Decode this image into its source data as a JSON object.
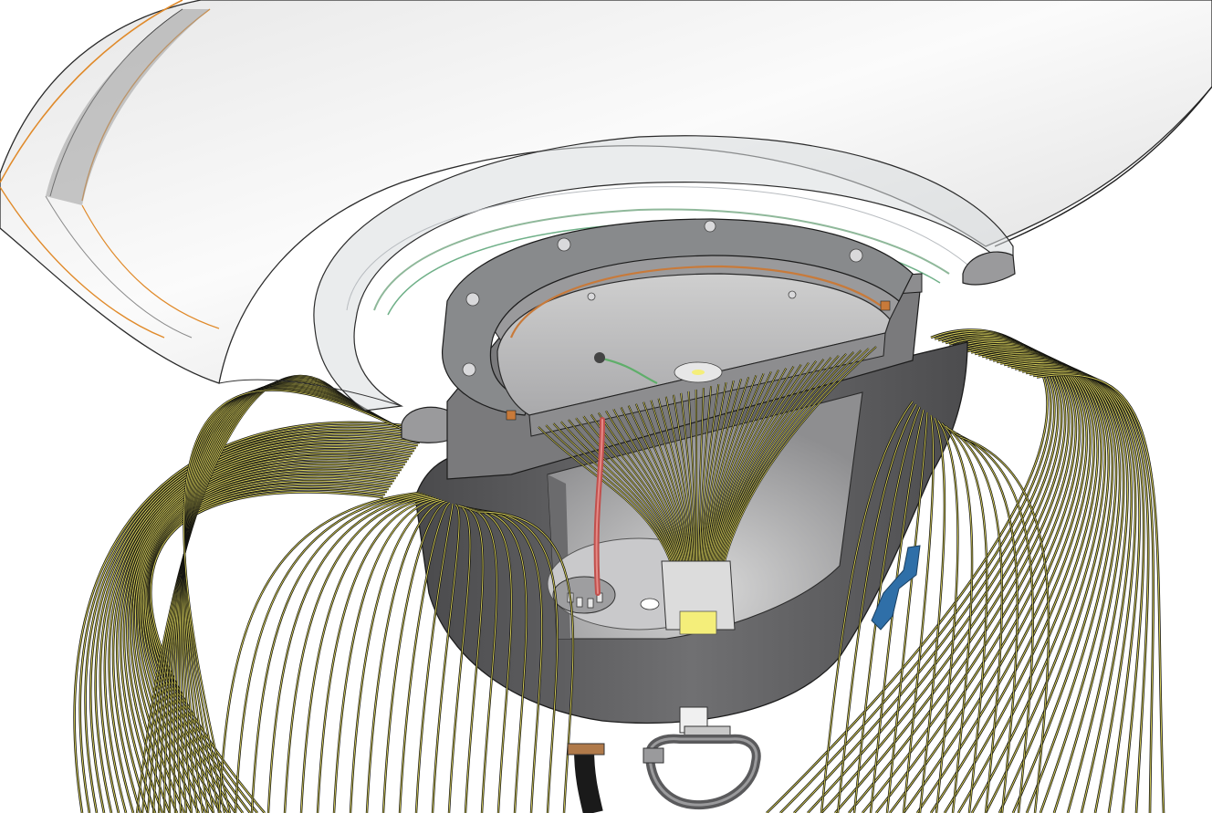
{
  "scene": {
    "background": "#ffffff",
    "palette": {
      "wire_dark": "#141410",
      "wire_yellow": "#d8d05a",
      "housing_dark": "#5c5c5e",
      "housing_mid": "#6e6e70",
      "housing_light": "#8a8a8c",
      "rim_glass": "#d9dcdf",
      "shade_light": "#f2f2f2",
      "shade_edge_orange": "#e08a2a",
      "seal_green": "#7fc48a",
      "copper_ring": "#c87a3a",
      "red_cable": "#c0504d",
      "blue_clip": "#2f6fa8",
      "led_yellow": "#f4ee7a"
    },
    "parts": [
      "lamp-shade",
      "glass-rim",
      "housing-section",
      "led-board",
      "fiber-bundle",
      "wire-cage",
      "red-cable",
      "blue-clip",
      "mount-bracket",
      "base-cable"
    ]
  }
}
